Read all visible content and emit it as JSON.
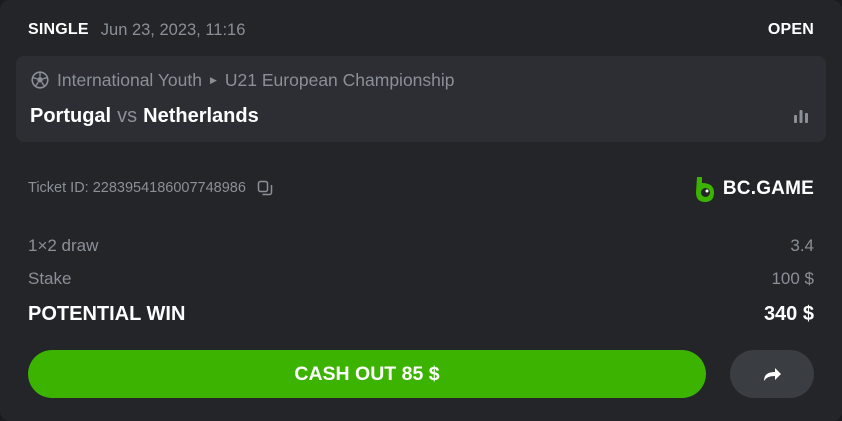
{
  "ticket": {
    "bet_type": "SINGLE",
    "date": "Jun 23, 2023, 11:16",
    "status": "OPEN",
    "ticket_id": "Ticket ID: 2283954186007748986"
  },
  "match": {
    "sport_icon": "soccer-ball-icon",
    "category": "International Youth",
    "tournament": "U21 European Championship",
    "home_team": "Portugal",
    "vs": "vs",
    "away_team": "Netherlands",
    "stats_icon": "bar-chart-icon"
  },
  "brand": {
    "name": "BC.GAME",
    "logo_icon": "bcgame-logo-icon",
    "color": "#3bb300"
  },
  "bet_lines": {
    "market_label": "1×2 draw",
    "odds": "3.4",
    "stake_label": "Stake",
    "stake_value": "100 $",
    "win_label": "POTENTIAL WIN",
    "win_value": "340 $"
  },
  "actions": {
    "cashout_label": "CASH OUT 85 $",
    "cashout_color": "#3bb300",
    "share_icon": "share-arrow-icon"
  },
  "colors": {
    "background": "#232529",
    "panel": "#2c2e33",
    "muted_text": "#8b8f97",
    "text": "#ffffff"
  }
}
